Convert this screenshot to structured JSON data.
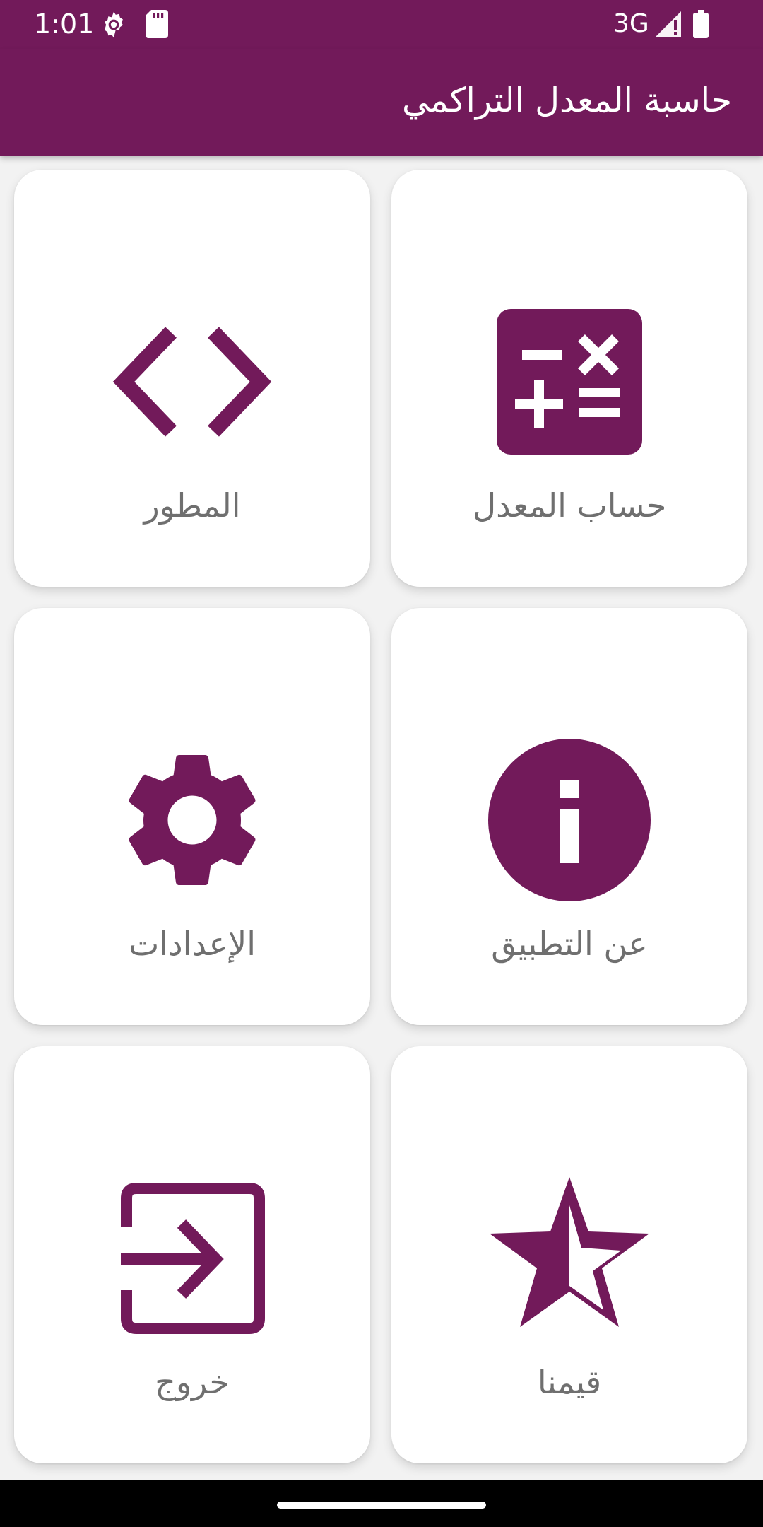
{
  "status_bar": {
    "time": "1:01",
    "network": "3G",
    "icons": [
      "settings-gear-icon",
      "sd-card-icon",
      "signal-icon",
      "battery-icon"
    ]
  },
  "app_bar": {
    "title": "حاسبة المعدل التراكمي",
    "color": "#721a5a"
  },
  "menu": {
    "accent_color": "#721a5a",
    "items": [
      {
        "label": "حساب المعدل",
        "icon": "calculator-icon"
      },
      {
        "label": "المطور",
        "icon": "code-icon"
      },
      {
        "label": "عن التطبيق",
        "icon": "info-icon"
      },
      {
        "label": "الإعدادات",
        "icon": "settings-icon"
      },
      {
        "label": "قيمنا",
        "icon": "star-half-icon"
      },
      {
        "label": "خروج",
        "icon": "exit-icon"
      }
    ]
  }
}
